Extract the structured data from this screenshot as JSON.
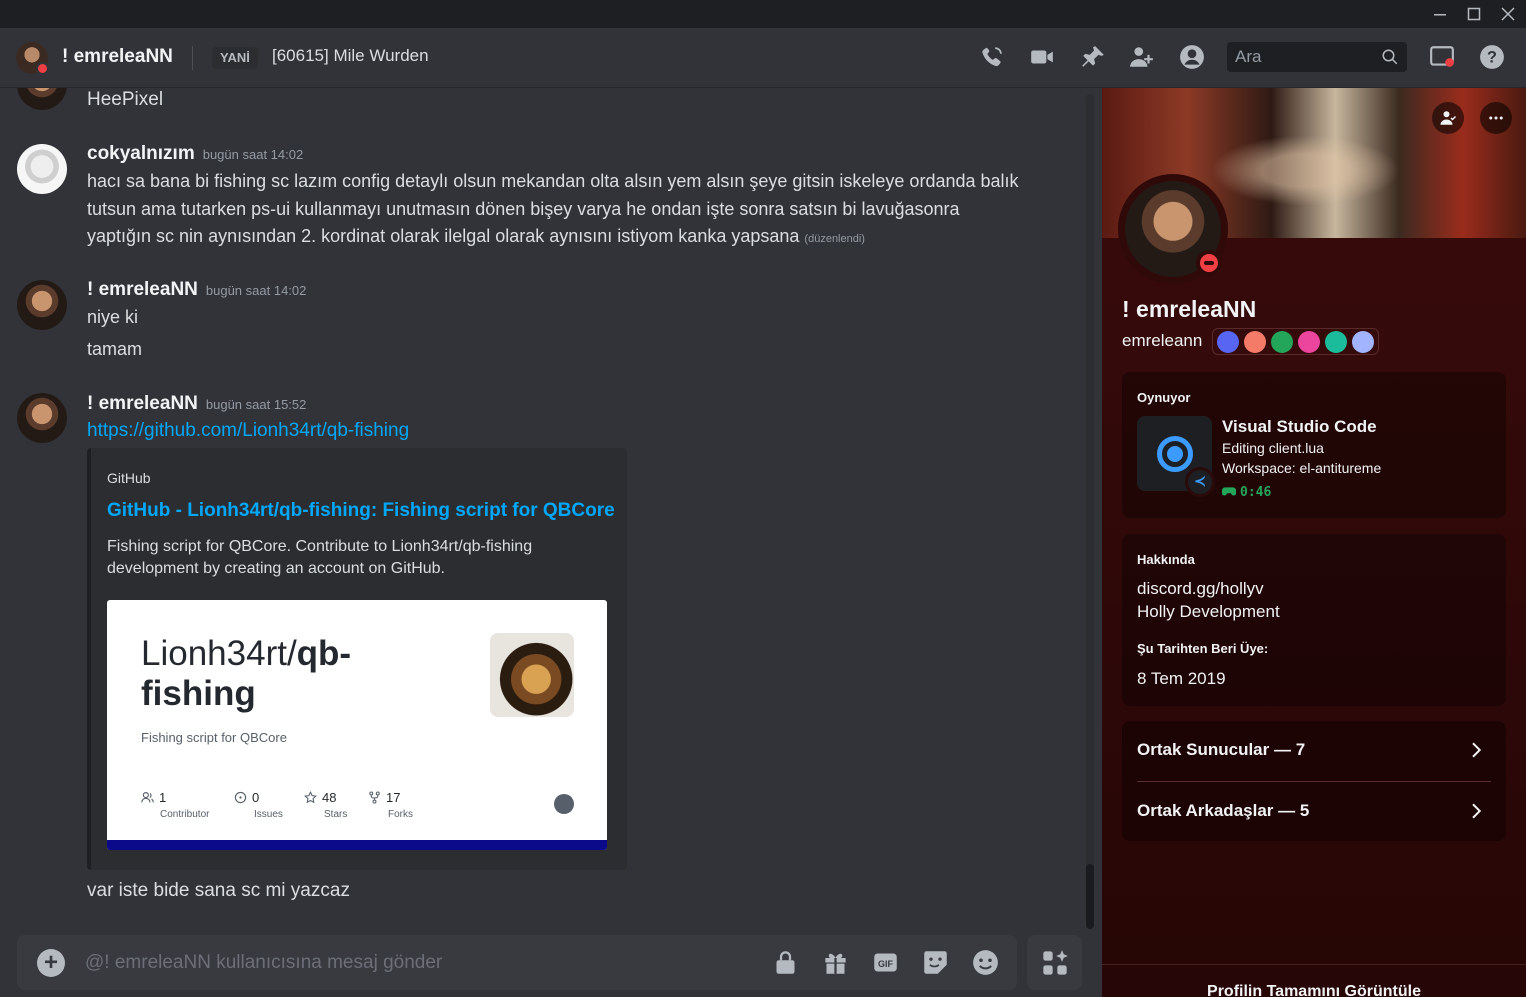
{
  "header": {
    "username": "! emreleaNN",
    "status_tag": "YANİ",
    "status_text": "[60615] Mile Wurden",
    "search_placeholder": "Ara"
  },
  "messages": [
    {
      "text": "HeePixel"
    },
    {
      "author": "cokyalnızım",
      "time": "bugün saat 14:02",
      "text": "hacı sa bana bi fishing sc lazım config detaylı olsun mekandan olta alsın yem alsın şeye gitsin iskeleye ordanda balık tutsun ama tutarken ps-ui kullanmayı unutmasın dönen bişey varya he ondan işte sonra satsın bi lavuğasonra yaptığın sc nin aynısından 2. kordinat olarak ilelgal olarak aynısını istiyom kanka yapsana",
      "edited": "(düzenlendi)"
    },
    {
      "author": "! emreleaNN",
      "time": "bugün saat 14:02",
      "lines": [
        "niye ki",
        "tamam"
      ]
    },
    {
      "author": "! emreleaNN",
      "time": "bugün saat 15:52",
      "link": "https://github.com/Lionh34rt/qb-fishing",
      "followup": "var iste bide sana sc mi yazcaz"
    }
  ],
  "embed": {
    "provider": "GitHub",
    "title": "GitHub - Lionh34rt/qb-fishing: Fishing script for QBCore",
    "description": "Fishing script for QBCore. Contribute to Lionh34rt/qb-fishing development by creating an account on GitHub.",
    "card": {
      "owner": "Lionh34rt/",
      "repo_part1": "qb-",
      "repo_part2": "fishing",
      "subtitle": "Fishing script for QBCore",
      "stats": [
        {
          "value": "1",
          "label": "Contributor",
          "icon": "people-icon"
        },
        {
          "value": "0",
          "label": "Issues",
          "icon": "issue-icon"
        },
        {
          "value": "48",
          "label": "Stars",
          "icon": "star-icon"
        },
        {
          "value": "17",
          "label": "Forks",
          "icon": "fork-icon"
        }
      ]
    }
  },
  "composer": {
    "placeholder": "@! emreleaNN kullanıcısına mesaj gönder"
  },
  "profile": {
    "display_name": "! emreleaNN",
    "username": "emreleann",
    "activity": {
      "label": "Oynuyor",
      "name": "Visual Studio Code",
      "details": "Editing client.lua",
      "state": "Workspace: el-antitureme",
      "elapsed": "0:46"
    },
    "about": {
      "label": "Hakkında",
      "lines": [
        "discord.gg/hollyv",
        "Holly Development"
      ],
      "member_since_label": "Şu Tarihten Beri Üye:",
      "member_since": "8 Tem 2019"
    },
    "mutual_servers": "Ortak Sunucular — 7",
    "mutual_friends": "Ortak Arkadaşlar — 5",
    "view_full": "Profilin Tamamını Görüntüle"
  },
  "colors": {
    "accent_link": "#00a8fc",
    "dnd": "#f23f43",
    "online_timer": "#23a55a",
    "profile_bg": "#2a0808"
  }
}
